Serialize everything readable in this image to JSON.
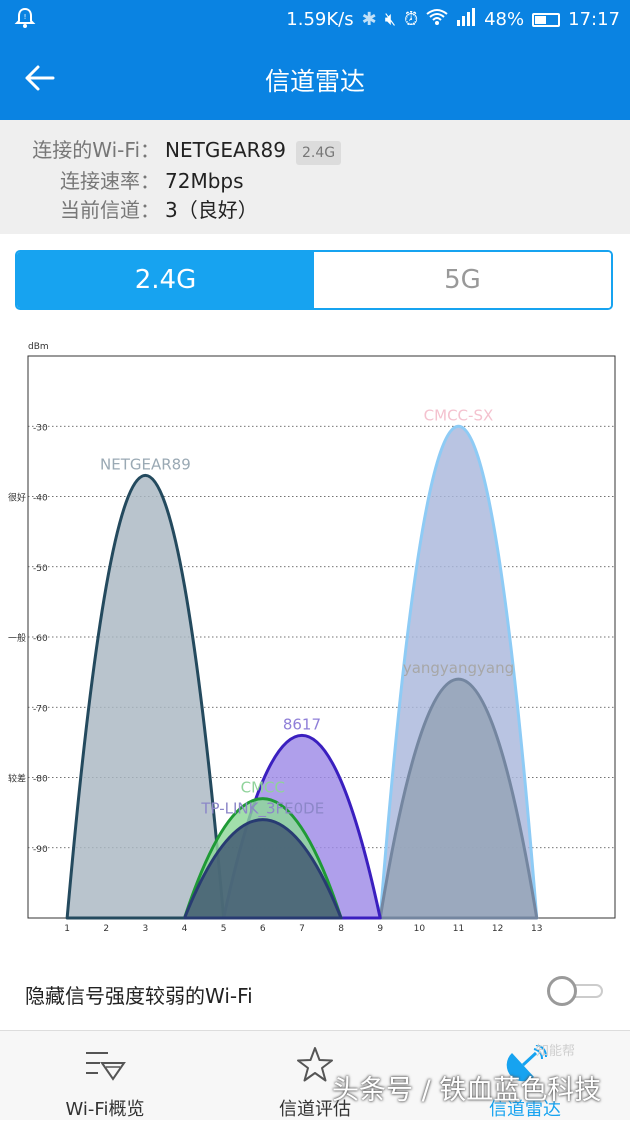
{
  "status_bar": {
    "speed": "1.59K/s",
    "battery": "48%",
    "battery_level": 0.48,
    "time": "17:17"
  },
  "app_bar": {
    "title": "信道雷达"
  },
  "connection": {
    "wifi_label": "连接的Wi-Fi：",
    "wifi_name": "NETGEAR89",
    "wifi_band": "2.4G",
    "speed_label": "连接速率：",
    "speed_value": "72Mbps",
    "channel_label": "当前信道：",
    "channel_value": "3（良好）"
  },
  "band_tabs": [
    {
      "label": "2.4G",
      "active": true
    },
    {
      "label": "5G",
      "active": false
    }
  ],
  "chart_data": {
    "type": "area",
    "y_unit": "dBm",
    "ylim": [
      -100,
      -20
    ],
    "xlim": [
      0,
      15
    ],
    "y_ticks": [
      -30,
      -40,
      -50,
      -60,
      -70,
      -80,
      -90
    ],
    "x_ticks": [
      1,
      2,
      3,
      4,
      5,
      6,
      7,
      8,
      9,
      10,
      11,
      12,
      13
    ],
    "grid": true,
    "quality_labels": [
      {
        "text": "很好",
        "y": -40
      },
      {
        "text": "一般",
        "y": -60
      },
      {
        "text": "较差",
        "y": -80
      }
    ],
    "networks": [
      {
        "name": "CMCC-SX",
        "channel": 11,
        "from": 9,
        "to": 13,
        "signal": -30,
        "stroke": "#8ecbf5",
        "fill": "#a9b7dc",
        "label_color": "#f4c2cf"
      },
      {
        "name": "yangyangyang",
        "channel": 11,
        "from": 9,
        "to": 13,
        "signal": -66,
        "stroke": "#7486a0",
        "fill": "#95a3b6",
        "label_color": "#a7a7a7"
      },
      {
        "name": "NETGEAR89",
        "channel": 3,
        "from": 1,
        "to": 5,
        "signal": -37,
        "stroke": "#244a5e",
        "fill": "#a9b7c2",
        "label_color": "#9aa9b4"
      },
      {
        "name": "8617",
        "channel": 7,
        "from": 5,
        "to": 9,
        "signal": -74,
        "stroke": "#3a1fbf",
        "fill": "#9e8ae6",
        "label_color": "#8f7fd8"
      },
      {
        "name": "CMCC",
        "channel": 6,
        "from": 4,
        "to": 8,
        "signal": -83,
        "stroke": "#1f9a36",
        "fill": "#8ed898",
        "label_color": "#8fd39a"
      },
      {
        "name": "TP-LINK_3FE0DE",
        "channel": 6,
        "from": 4,
        "to": 8,
        "signal": -86,
        "stroke": "#283b72",
        "fill": "#3f5670",
        "label_color": "#8c87c8"
      }
    ]
  },
  "hide_weak": {
    "label": "隐藏信号强度较弱的Wi-Fi",
    "enabled": false
  },
  "bottom_nav": [
    {
      "label": "Wi-Fi概览",
      "icon": "wifi-overview-icon",
      "active": false
    },
    {
      "label": "信道评估",
      "icon": "star-icon",
      "active": false
    },
    {
      "label": "信道雷达",
      "icon": "radar-icon",
      "active": true
    }
  ],
  "overlay": {
    "watermark": "头条号 / 铁血蓝色科技",
    "corner_mark": "知能帮"
  },
  "colors": {
    "primary": "#0a83e2",
    "tab_active": "#17a3f0"
  }
}
